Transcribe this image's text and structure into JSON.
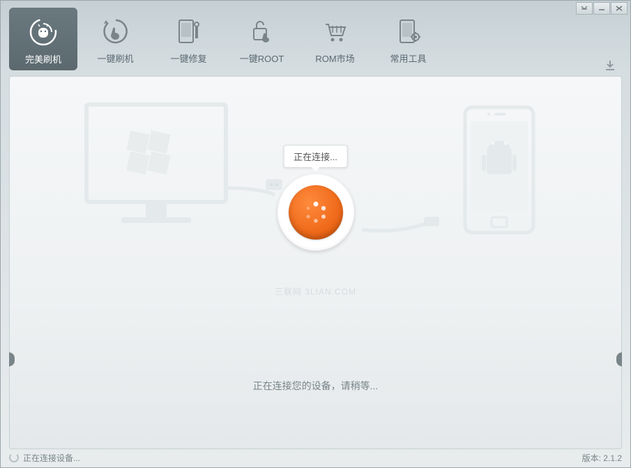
{
  "toolbar": {
    "items": [
      {
        "label": "完美刷机",
        "icon": "android-refresh-icon"
      },
      {
        "label": "一键刷机",
        "icon": "hand-refresh-icon"
      },
      {
        "label": "一键修复",
        "icon": "phone-wrench-icon"
      },
      {
        "label": "一键ROOT",
        "icon": "lock-hand-icon"
      },
      {
        "label": "ROM市场",
        "icon": "cart-icon"
      },
      {
        "label": "常用工具",
        "icon": "phone-gear-icon"
      }
    ]
  },
  "tooltip": {
    "text": "正在连接..."
  },
  "watermark": "三联网 3LIAN.COM",
  "status_message": "正在连接您的设备，请稍等...",
  "footer": {
    "status": "正在连接设备...",
    "version_label": "版本: 2.1.2"
  },
  "colors": {
    "accent": "#ef6a1a"
  }
}
